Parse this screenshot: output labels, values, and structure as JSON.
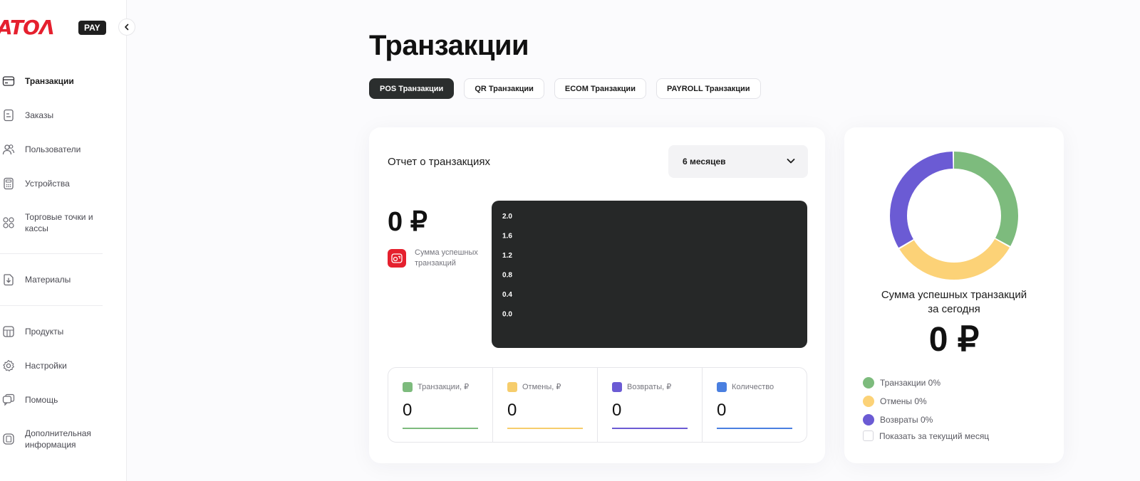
{
  "brand": {
    "logo_text": "ATOΛ",
    "pay_badge": "PAY"
  },
  "sidebar": {
    "items": [
      {
        "label": "Транзакции",
        "icon": "card-icon"
      },
      {
        "label": "Заказы",
        "icon": "document-icon"
      },
      {
        "label": "Пользователи",
        "icon": "users-icon"
      },
      {
        "label": "Устройства",
        "icon": "calculator-icon"
      },
      {
        "label": "Торговые точки и кассы",
        "icon": "store-icon"
      },
      {
        "label": "Материалы",
        "icon": "download-icon"
      },
      {
        "label": "Продукты",
        "icon": "product-icon"
      },
      {
        "label": "Настройки",
        "icon": "gear-icon"
      },
      {
        "label": "Помощь",
        "icon": "chat-icon"
      },
      {
        "label": "Дополнительная информация",
        "icon": "book-icon"
      }
    ]
  },
  "main": {
    "title": "Транзакции",
    "tabs": [
      {
        "label": "POS Транзакции",
        "active": true
      },
      {
        "label": "QR Транзакции",
        "active": false
      },
      {
        "label": "ECOM Транзакции",
        "active": false
      },
      {
        "label": "PAYROLL Транзакции",
        "active": false
      }
    ]
  },
  "report": {
    "title": "Отчет о транзакциях",
    "period": "6 месяцев",
    "sum_value": "0 ₽",
    "sum_label": "Сумма успешных транзакций",
    "stats": [
      {
        "label": "Транзакции, ₽",
        "value": "0",
        "color": "#7dbb7d"
      },
      {
        "label": "Отмены, ₽",
        "value": "0",
        "color": "#f6cd6c"
      },
      {
        "label": "Возвраты, ₽",
        "value": "0",
        "color": "#6b5bd4"
      },
      {
        "label": "Количество",
        "value": "0",
        "color": "#4a7fe0"
      }
    ]
  },
  "chart_data": {
    "type": "line",
    "yticks": [
      "2.0",
      "1.6",
      "1.2",
      "0.8",
      "0.4",
      "0.0"
    ],
    "ylim": [
      0,
      2.0
    ],
    "series": [],
    "background": "#262828"
  },
  "donut": {
    "caption_line1": "Сумма успешных транзакций",
    "caption_line2": "за сегодня",
    "sum_value": "0 ₽",
    "segments": [
      {
        "color": "#7dbb7d",
        "fraction": 0.333
      },
      {
        "color": "#fcd277",
        "fraction": 0.333
      },
      {
        "color": "#6b5bd4",
        "fraction": 0.334
      }
    ],
    "legend": [
      {
        "label": "Транзакции 0%",
        "color": "#7dbb7d"
      },
      {
        "label": "Отмены 0%",
        "color": "#fcd277"
      },
      {
        "label": "Возвраты 0%",
        "color": "#6b5bd4"
      }
    ],
    "checkbox_label": "Показать за текущий месяц"
  }
}
